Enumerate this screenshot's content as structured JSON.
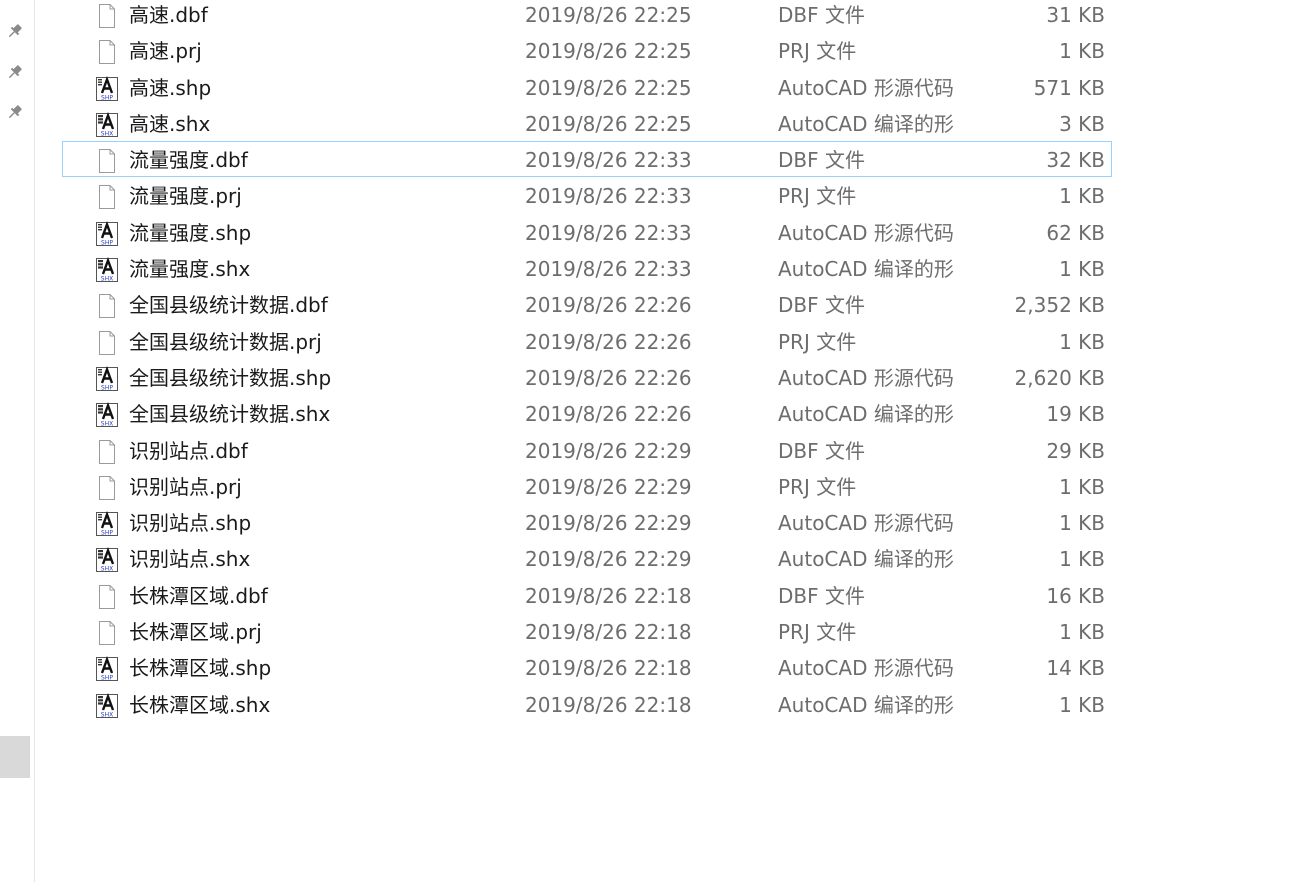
{
  "nav_pane": {
    "pins": [
      "pin-icon",
      "pin-icon",
      "pin-icon"
    ],
    "colors": {
      "pin": "#8a8a8a",
      "selected_bg": "#d9d9d9"
    }
  },
  "files": [
    {
      "name": "高速.dbf",
      "date": "2019/8/26 22:25",
      "type": "DBF 文件",
      "size": "31 KB",
      "icon": "blank-file-icon"
    },
    {
      "name": "高速.prj",
      "date": "2019/8/26 22:25",
      "type": "PRJ 文件",
      "size": "1 KB",
      "icon": "blank-file-icon"
    },
    {
      "name": "高速.shp",
      "date": "2019/8/26 22:25",
      "type": "AutoCAD 形源代码",
      "size": "571 KB",
      "icon": "autocad-shp-icon"
    },
    {
      "name": "高速.shx",
      "date": "2019/8/26 22:25",
      "type": "AutoCAD 编译的形",
      "size": "3 KB",
      "icon": "autocad-shx-icon"
    },
    {
      "name": "流量强度.dbf",
      "date": "2019/8/26 22:33",
      "type": "DBF 文件",
      "size": "32 KB",
      "icon": "blank-file-icon",
      "focused": true
    },
    {
      "name": "流量强度.prj",
      "date": "2019/8/26 22:33",
      "type": "PRJ 文件",
      "size": "1 KB",
      "icon": "blank-file-icon"
    },
    {
      "name": "流量强度.shp",
      "date": "2019/8/26 22:33",
      "type": "AutoCAD 形源代码",
      "size": "62 KB",
      "icon": "autocad-shp-icon"
    },
    {
      "name": "流量强度.shx",
      "date": "2019/8/26 22:33",
      "type": "AutoCAD 编译的形",
      "size": "1 KB",
      "icon": "autocad-shx-icon"
    },
    {
      "name": "全国县级统计数据.dbf",
      "date": "2019/8/26 22:26",
      "type": "DBF 文件",
      "size": "2,352 KB",
      "icon": "blank-file-icon"
    },
    {
      "name": "全国县级统计数据.prj",
      "date": "2019/8/26 22:26",
      "type": "PRJ 文件",
      "size": "1 KB",
      "icon": "blank-file-icon"
    },
    {
      "name": "全国县级统计数据.shp",
      "date": "2019/8/26 22:26",
      "type": "AutoCAD 形源代码",
      "size": "2,620 KB",
      "icon": "autocad-shp-icon"
    },
    {
      "name": "全国县级统计数据.shx",
      "date": "2019/8/26 22:26",
      "type": "AutoCAD 编译的形",
      "size": "19 KB",
      "icon": "autocad-shx-icon"
    },
    {
      "name": "识别站点.dbf",
      "date": "2019/8/26 22:29",
      "type": "DBF 文件",
      "size": "29 KB",
      "icon": "blank-file-icon"
    },
    {
      "name": "识别站点.prj",
      "date": "2019/8/26 22:29",
      "type": "PRJ 文件",
      "size": "1 KB",
      "icon": "blank-file-icon"
    },
    {
      "name": "识别站点.shp",
      "date": "2019/8/26 22:29",
      "type": "AutoCAD 形源代码",
      "size": "1 KB",
      "icon": "autocad-shp-icon"
    },
    {
      "name": "识别站点.shx",
      "date": "2019/8/26 22:29",
      "type": "AutoCAD 编译的形",
      "size": "1 KB",
      "icon": "autocad-shx-icon"
    },
    {
      "name": "长株潭区域.dbf",
      "date": "2019/8/26 22:18",
      "type": "DBF 文件",
      "size": "16 KB",
      "icon": "blank-file-icon"
    },
    {
      "name": "长株潭区域.prj",
      "date": "2019/8/26 22:18",
      "type": "PRJ 文件",
      "size": "1 KB",
      "icon": "blank-file-icon"
    },
    {
      "name": "长株潭区域.shp",
      "date": "2019/8/26 22:18",
      "type": "AutoCAD 形源代码",
      "size": "14 KB",
      "icon": "autocad-shp-icon"
    },
    {
      "name": "长株潭区域.shx",
      "date": "2019/8/26 22:18",
      "type": "AutoCAD 编译的形",
      "size": "1 KB",
      "icon": "autocad-shx-icon"
    }
  ],
  "colors": {
    "focus_border": "#99d1ff",
    "secondary_text": "#6d6d6d",
    "primary_text": "#1a1a1a",
    "shx_icon_label": "#2b3dbb"
  }
}
